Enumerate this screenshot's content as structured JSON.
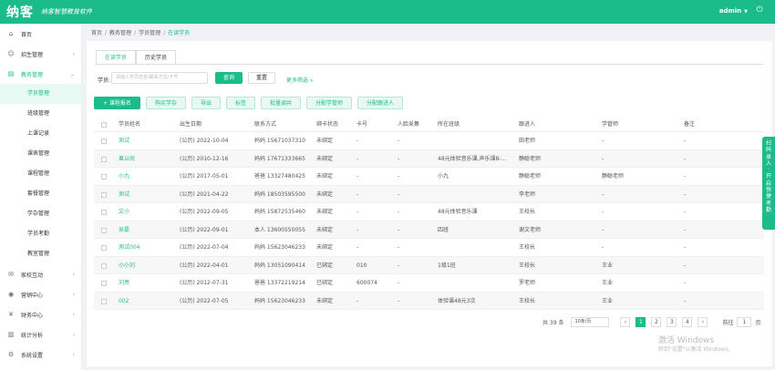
{
  "header": {
    "logo": "纳客",
    "slogan": "纳客智慧教育软件",
    "user": "admin",
    "user_caret": "▼"
  },
  "sidebar": {
    "items": [
      {
        "label": "首页",
        "icon": "home-icon"
      },
      {
        "label": "招生管理",
        "icon": "user-add-icon"
      },
      {
        "label": "教务管理",
        "icon": "book-icon"
      },
      {
        "label": "家校互动",
        "icon": "chat-icon"
      },
      {
        "label": "营销中心",
        "icon": "megaphone-icon"
      },
      {
        "label": "财务中心",
        "icon": "wallet-icon"
      },
      {
        "label": "统计分析",
        "icon": "chart-icon"
      },
      {
        "label": "系统设置",
        "icon": "gear-icon"
      }
    ],
    "subitems": [
      "学员管理",
      "班级管理",
      "上课记录",
      "课表管理",
      "课程管理",
      "套餐管理",
      "学杂管理",
      "学员考勤",
      "教室管理"
    ]
  },
  "breadcrumb": [
    "首页",
    "教务管理",
    "学员管理",
    "在读学员"
  ],
  "tabs": [
    "在读学员",
    "历史学员"
  ],
  "filter": {
    "label": "学员:",
    "placeholder": "请输入学员姓名/联系方式/卡号",
    "search": "查询",
    "reset": "重置",
    "more": "更多筛选 »"
  },
  "actions": [
    "+ 课程报名",
    "购买学杂",
    "导出",
    "标签",
    "批量调共",
    "分配学管师",
    "分配跟进人"
  ],
  "table": {
    "headers": [
      "学员姓名",
      "出生日期",
      "联系方式",
      "绑卡状态",
      "卡号",
      "人脸采集",
      "所在班级",
      "跟进人",
      "学管师",
      "备注"
    ],
    "rows": [
      [
        "测试",
        "(公历) 2022-10-04",
        "妈妈 15671037310",
        "未绑定",
        "-",
        "-",
        "",
        "田老师",
        "-",
        "-"
      ],
      [
        "果以尚",
        "(公历) 2010-12-16",
        "妈妈 17671333665",
        "未绑定",
        "-",
        "-",
        "48元体验音乐课,声乐课8-...",
        "静聪老师",
        "-",
        "-"
      ],
      [
        "小九",
        "(公历) 2017-05-01",
        "爸爸 13327480425",
        "未绑定",
        "-",
        "-",
        "小九",
        "静聪老师",
        "静聪老师",
        "-"
      ],
      [
        "测试",
        "(公历) 2021-04-22",
        "妈妈 18503595500",
        "未绑定",
        "-",
        "-",
        "",
        "李老师",
        "-",
        "-"
      ],
      [
        "文小",
        "(公历) 2022-09-05",
        "妈妈 15872535460",
        "未绑定",
        "-",
        "-",
        "48元体验音乐课",
        "王校长",
        "-",
        "-"
      ],
      [
        "吴磊",
        "(公历) 2022-09-01",
        "本人 13600550055",
        "未绑定",
        "-",
        "-",
        "四班",
        "谢文老师",
        "-",
        "-"
      ],
      [
        "测试004",
        "(公历) 2022-07-04",
        "妈妈 15623046233",
        "未绑定",
        "-",
        "-",
        "",
        "王校长",
        "-",
        "-"
      ],
      [
        "小小刘",
        "(公历) 2022-04-01",
        "妈妈 13051090414",
        "已绑定",
        "010",
        "-",
        "1级1班",
        "王校长",
        "王业",
        "-"
      ],
      [
        "刘亮",
        "(公历) 2012-07-31",
        "爸爸 13372219214",
        "已绑定",
        "600074",
        "-",
        "",
        "罗老师",
        "王业",
        "-"
      ],
      [
        "002",
        "(公历) 2022-07-05",
        "妈妈 15623046233",
        "未绑定",
        "-",
        "-",
        "体验课48元3次",
        "王校长",
        "王业",
        "-"
      ]
    ]
  },
  "pager": {
    "total": "共 39 条",
    "per_page": "10条/页",
    "pages": [
      "1",
      "2",
      "3",
      "4"
    ],
    "prev": "‹",
    "next": "›",
    "goto": "前往",
    "goto_value": "1",
    "page_unit": "页"
  },
  "watermark": {
    "line1": "激活 Windows",
    "line2": "转到\"设置\"以激活 Windows。"
  },
  "float_button": "扫码录入·开启快捷考勤"
}
